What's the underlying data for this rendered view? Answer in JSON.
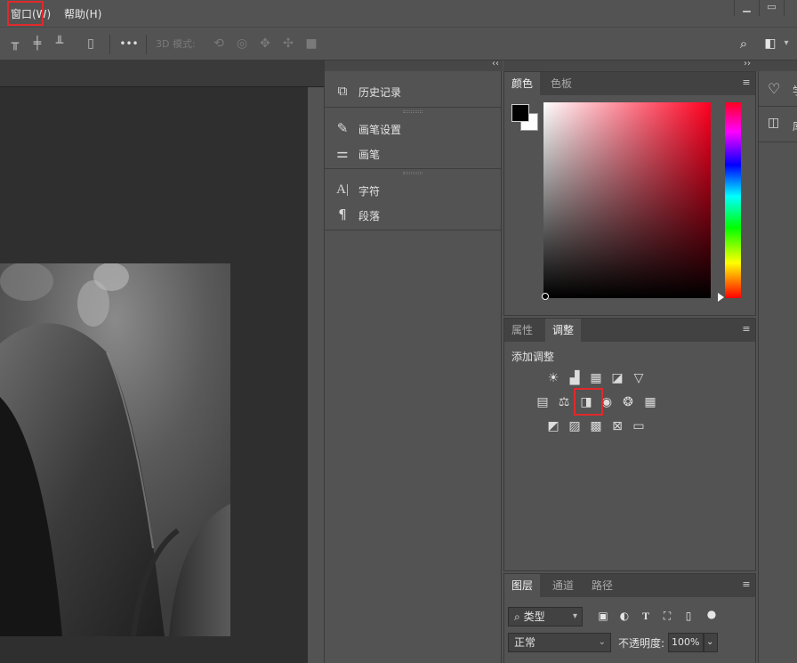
{
  "menubar": {
    "items": [
      {
        "label": "窗口(W)"
      },
      {
        "label": "帮助(H)"
      }
    ],
    "highlight_color": "#e0292c",
    "window_controls": [
      "minimize-icon",
      "restore-icon"
    ]
  },
  "options_bar": {
    "more_label": "•••",
    "mode_3d_label": "3D 模式:",
    "icons": [
      "align-top-icon",
      "align-vcenter-icon",
      "align-bottom-icon",
      "distribute-icon",
      "more-icon",
      "3d-orbit-icon",
      "3d-roll-icon",
      "3d-pan-icon",
      "3d-slide-icon",
      "3d-camera-icon",
      "search-icon",
      "workspace-icon"
    ]
  },
  "dock": {
    "collapse_glyph": "‹‹",
    "groups": [
      {
        "items": [
          {
            "label": "历史记录",
            "icon": "history-icon"
          }
        ]
      },
      {
        "items": [
          {
            "label": "画笔设置",
            "icon": "brush-settings-icon"
          },
          {
            "label": "画笔",
            "icon": "brush-icon"
          }
        ]
      },
      {
        "items": [
          {
            "label": "字符",
            "icon": "character-icon"
          },
          {
            "label": "段落",
            "icon": "paragraph-icon"
          }
        ]
      }
    ]
  },
  "color_panel": {
    "tabs": [
      {
        "label": "颜色",
        "active": true
      },
      {
        "label": "色板",
        "active": false
      }
    ],
    "foreground": "#000000",
    "background": "#ffffff",
    "hue_color": "#ff0020",
    "expand_glyph": "››"
  },
  "adjustments_panel": {
    "tabs": [
      {
        "label": "属性",
        "active": false
      },
      {
        "label": "调整",
        "active": true
      }
    ],
    "title": "添加调整",
    "rows": [
      [
        "brightness-contrast-icon",
        "levels-icon",
        "curves-icon",
        "exposure-icon",
        "vibrance-icon"
      ],
      [
        "hue-saturation-icon",
        "color-balance-icon",
        "black-white-icon",
        "photo-filter-icon",
        "channel-mixer-icon",
        "color-lookup-icon"
      ],
      [
        "invert-icon",
        "posterize-icon",
        "threshold-icon",
        "selective-color-icon",
        "gradient-map-icon"
      ]
    ],
    "highlighted": "black-white-icon"
  },
  "layers_panel": {
    "tabs": [
      {
        "label": "图层",
        "active": true
      },
      {
        "label": "通道",
        "active": false
      },
      {
        "label": "路径",
        "active": false
      }
    ],
    "filter_label": "类型",
    "blend_mode": "正常",
    "opacity_label": "不透明度:",
    "opacity_value": "100%",
    "filter_icons": [
      "image-filter-icon",
      "adjustment-filter-icon",
      "type-filter-icon",
      "shape-filter-icon",
      "smart-object-filter-icon",
      "filter-toggle-icon"
    ]
  },
  "far_right": {
    "icons": [
      "learn-icon",
      "libraries-icon"
    ],
    "labels": [
      "学",
      "库"
    ]
  }
}
